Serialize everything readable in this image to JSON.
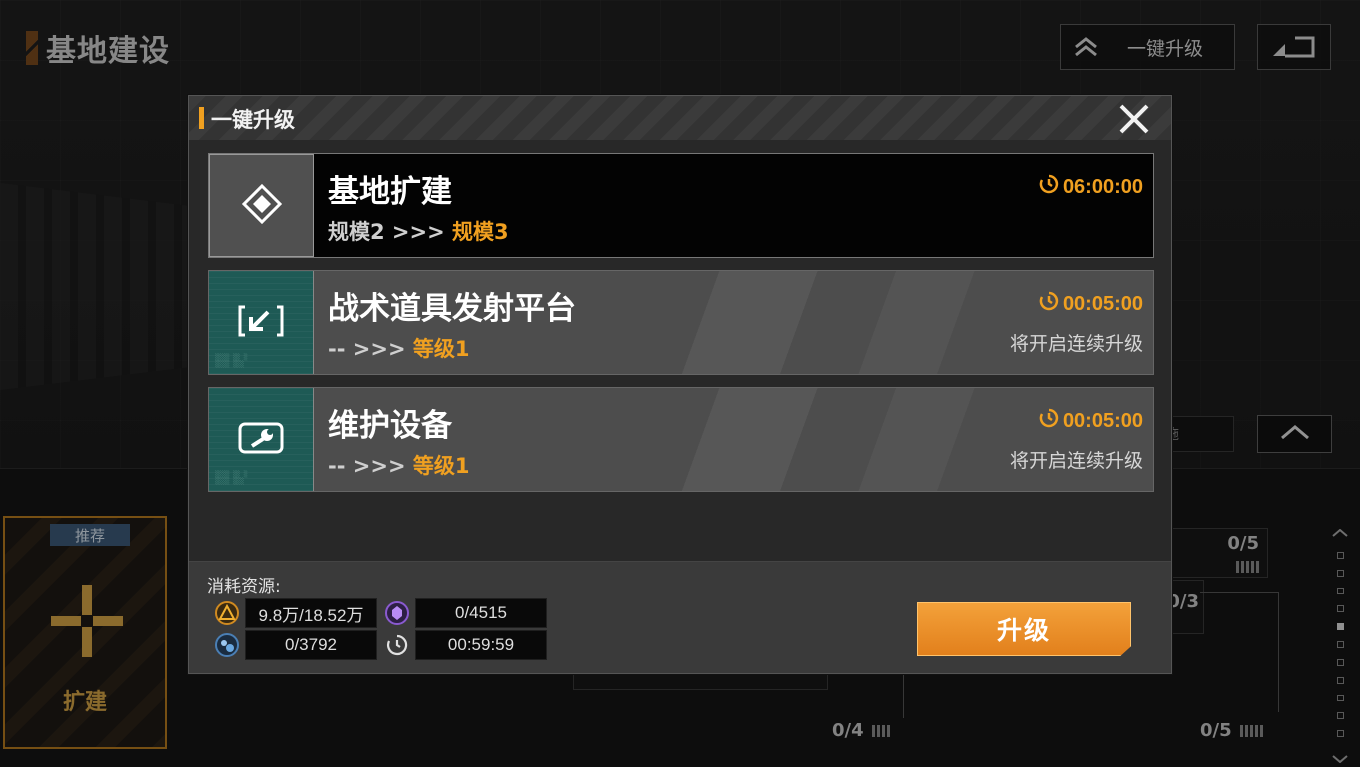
{
  "page": {
    "title": "基地建设",
    "top_bar": {
      "upgrade_all_label": "一键升级"
    }
  },
  "background": {
    "recommend_card": {
      "tag": "推荐",
      "label": "扩建"
    },
    "counters": [
      "0/5",
      "0/3",
      "0/4",
      "0/5"
    ],
    "side_tag_text": "施"
  },
  "modal": {
    "title": "一键升级",
    "tasks": [
      {
        "name": "基地扩建",
        "level_from": "规模2",
        "arrow": " >>> ",
        "level_to": "规模3",
        "timer": "06:00:00",
        "note": "",
        "icon": "diamond-icon"
      },
      {
        "name": "战术道具发射平台",
        "level_from": "--",
        "arrow": " >>> ",
        "level_to": "等级1",
        "timer": "00:05:00",
        "note": "将开启连续升级",
        "icon": "launch-icon"
      },
      {
        "name": "维护设备",
        "level_from": "--",
        "arrow": " >>> ",
        "level_to": "等级1",
        "timer": "00:05:00",
        "note": "将开启连续升级",
        "icon": "wrench-icon"
      }
    ],
    "costs": {
      "label": "消耗资源:",
      "resources": [
        {
          "icon": "material-triangle-icon",
          "value": "9.8万/18.52万"
        },
        {
          "icon": "purple-crystal-icon",
          "value": "0/4515"
        },
        {
          "icon": "blue-component-icon",
          "value": "0/3792"
        },
        {
          "icon": "clock-icon",
          "value": "00:59:59"
        }
      ]
    },
    "upgrade_button": "升级"
  },
  "colors": {
    "accent_orange": "#f0a020",
    "teal_icon_bg": "#1e5a55",
    "button_orange": "#e88a24"
  }
}
